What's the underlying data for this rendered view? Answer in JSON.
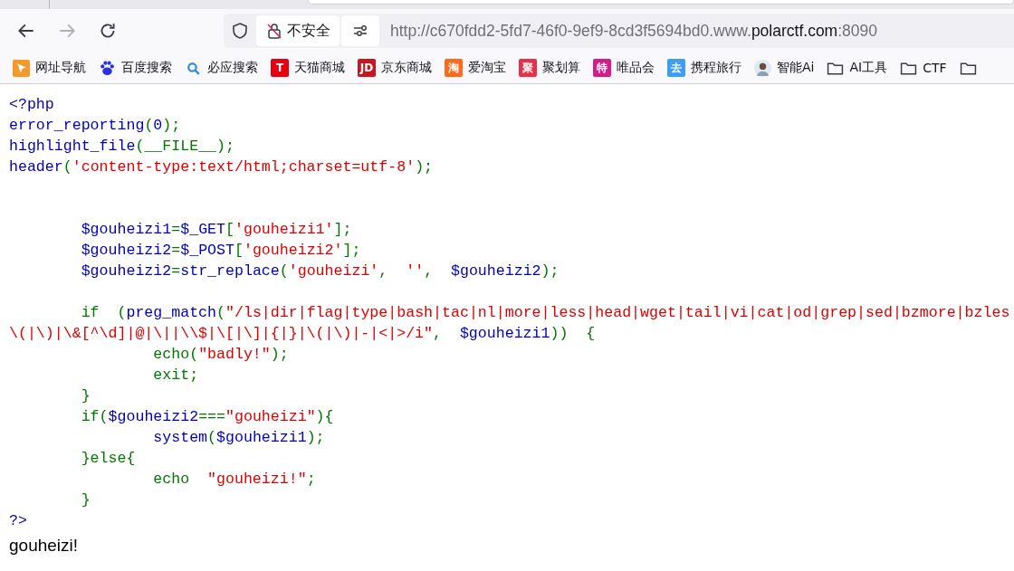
{
  "toolbar": {
    "security_label": "不安全",
    "url": {
      "prefix": "http://c670fdd2-5fd7-46f0-9ef9-8cd3f5694bd0.www.",
      "domain": "polarctf.com",
      "suffix": ":8090"
    }
  },
  "bookmarks": [
    {
      "kind": "arrow",
      "label": "网址导航"
    },
    {
      "kind": "paw",
      "label": "百度搜索"
    },
    {
      "kind": "search",
      "label": "必应搜索"
    },
    {
      "kind": "logo",
      "logo": "T",
      "color": "#e60012",
      "label": "天猫商城"
    },
    {
      "kind": "logo",
      "logo": "JD",
      "color": "#c7161e",
      "label": "京东商城"
    },
    {
      "kind": "logo",
      "logo": "淘",
      "color": "#ff6a1a",
      "label": "爱淘宝"
    },
    {
      "kind": "logo",
      "logo": "聚",
      "color": "#e8304a",
      "label": "聚划算"
    },
    {
      "kind": "logo",
      "logo": "特",
      "color": "#d6198b",
      "label": "唯品会"
    },
    {
      "kind": "logo",
      "logo": "去",
      "color": "#3d9ef5",
      "label": "携程旅行"
    },
    {
      "kind": "avatar",
      "label": "智能Ai"
    },
    {
      "kind": "folder",
      "label": "AI工具"
    },
    {
      "kind": "folder",
      "label": "CTF"
    },
    {
      "kind": "folder"
    }
  ],
  "code_lines": [
    {
      "kind": "code",
      "tokens": [
        {
          "kind": "default",
          "text": "<?php"
        }
      ]
    },
    {
      "kind": "code",
      "tokens": [
        {
          "kind": "default",
          "text": "error_reporting"
        },
        {
          "kind": "keyword",
          "text": "("
        },
        {
          "kind": "default",
          "text": "0"
        },
        {
          "kind": "keyword",
          "text": ");"
        }
      ]
    },
    {
      "kind": "code",
      "tokens": [
        {
          "kind": "default",
          "text": "highlight_file"
        },
        {
          "kind": "keyword",
          "text": "(__FILE__);"
        }
      ]
    },
    {
      "kind": "code",
      "tokens": [
        {
          "kind": "default",
          "text": "header"
        },
        {
          "kind": "keyword",
          "text": "("
        },
        {
          "kind": "string",
          "text": "'content-type:text/html;charset=utf-8'"
        },
        {
          "kind": "keyword",
          "text": ");"
        }
      ]
    },
    {
      "kind": "blank"
    },
    {
      "kind": "blank"
    },
    {
      "kind": "code",
      "tokens": [
        {
          "kind": "default",
          "text": "        $gouheizi1"
        },
        {
          "kind": "keyword",
          "text": "="
        },
        {
          "kind": "default",
          "text": "$_GET"
        },
        {
          "kind": "keyword",
          "text": "["
        },
        {
          "kind": "string",
          "text": "'gouheizi1'"
        },
        {
          "kind": "keyword",
          "text": "];"
        }
      ]
    },
    {
      "kind": "code",
      "tokens": [
        {
          "kind": "default",
          "text": "        $gouheizi2"
        },
        {
          "kind": "keyword",
          "text": "="
        },
        {
          "kind": "default",
          "text": "$_POST"
        },
        {
          "kind": "keyword",
          "text": "["
        },
        {
          "kind": "string",
          "text": "'gouheizi2'"
        },
        {
          "kind": "keyword",
          "text": "];"
        }
      ]
    },
    {
      "kind": "code",
      "tokens": [
        {
          "kind": "default",
          "text": "        $gouheizi2"
        },
        {
          "kind": "keyword",
          "text": "="
        },
        {
          "kind": "default",
          "text": "str_replace"
        },
        {
          "kind": "keyword",
          "text": "("
        },
        {
          "kind": "string",
          "text": "'gouheizi'"
        },
        {
          "kind": "keyword",
          "text": ",  "
        },
        {
          "kind": "string",
          "text": "''"
        },
        {
          "kind": "keyword",
          "text": ",  "
        },
        {
          "kind": "default",
          "text": "$gouheizi2"
        },
        {
          "kind": "keyword",
          "text": ");"
        }
      ]
    },
    {
      "kind": "blank"
    },
    {
      "kind": "code",
      "tokens": [
        {
          "kind": "keyword",
          "text": "        if  ("
        },
        {
          "kind": "default",
          "text": "preg_match"
        },
        {
          "kind": "keyword",
          "text": "("
        },
        {
          "kind": "string",
          "text": "\"/ls|dir|flag|type|bash|tac|nl|more|less|head|wget|tail|vi|cat|od|grep|sed|bzmore|bzles"
        }
      ]
    },
    {
      "kind": "code",
      "tokens": [
        {
          "kind": "string",
          "text": "\\(|\\)|\\&[^\\d]|@|\\||\\\\$|\\[|\\]|{|}|\\(|\\)|-|<|>/i\""
        },
        {
          "kind": "keyword",
          "text": ",  "
        },
        {
          "kind": "default",
          "text": "$gouheizi1"
        },
        {
          "kind": "keyword",
          "text": "))  {"
        }
      ]
    },
    {
      "kind": "code",
      "tokens": [
        {
          "kind": "keyword",
          "text": "                echo("
        },
        {
          "kind": "string",
          "text": "\"badly!\""
        },
        {
          "kind": "keyword",
          "text": ");"
        }
      ]
    },
    {
      "kind": "code",
      "tokens": [
        {
          "kind": "keyword",
          "text": "                exit;"
        }
      ]
    },
    {
      "kind": "code",
      "tokens": [
        {
          "kind": "keyword",
          "text": "        }"
        }
      ]
    },
    {
      "kind": "code",
      "tokens": [
        {
          "kind": "keyword",
          "text": "        if("
        },
        {
          "kind": "default",
          "text": "$gouheizi2"
        },
        {
          "kind": "keyword",
          "text": "==="
        },
        {
          "kind": "string",
          "text": "\"gouheizi\""
        },
        {
          "kind": "keyword",
          "text": "){"
        }
      ]
    },
    {
      "kind": "code",
      "tokens": [
        {
          "kind": "default",
          "text": "                system"
        },
        {
          "kind": "keyword",
          "text": "("
        },
        {
          "kind": "default",
          "text": "$gouheizi1"
        },
        {
          "kind": "keyword",
          "text": ");"
        }
      ]
    },
    {
      "kind": "code",
      "tokens": [
        {
          "kind": "keyword",
          "text": "        }else{"
        }
      ]
    },
    {
      "kind": "code",
      "tokens": [
        {
          "kind": "keyword",
          "text": "                echo  "
        },
        {
          "kind": "string",
          "text": "\"gouheizi!\""
        },
        {
          "kind": "keyword",
          "text": ";"
        }
      ]
    },
    {
      "kind": "code",
      "tokens": [
        {
          "kind": "keyword",
          "text": "        }"
        }
      ]
    },
    {
      "kind": "code",
      "tokens": [
        {
          "kind": "default",
          "text": "?>"
        }
      ]
    }
  ],
  "output": "gouheizi!"
}
